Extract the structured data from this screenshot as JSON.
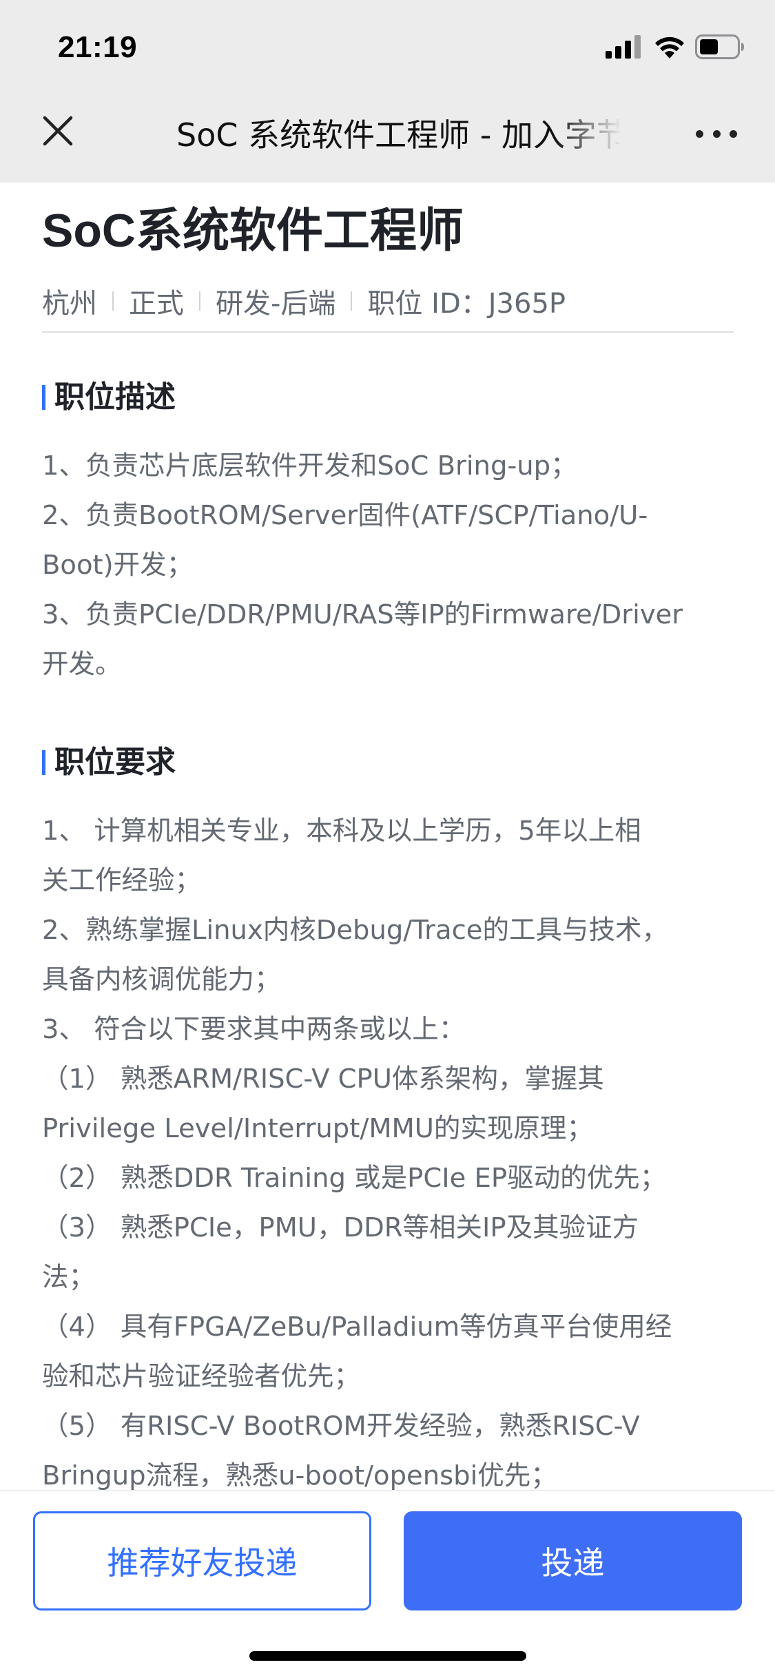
{
  "status_bar": {
    "time": "21:19",
    "icons": [
      "cellular-signal-icon",
      "wifi-icon",
      "battery-icon"
    ],
    "battery_level": 0.5
  },
  "nav": {
    "close_icon": "close-icon",
    "title": "SoC 系统软件工程师 - 加入字节跳动",
    "more_icon": "more-dots-icon"
  },
  "job": {
    "title": "SoC系统软件工程师",
    "meta": {
      "city": "杭州",
      "type": "正式",
      "category": "研发-后端",
      "job_id": "职位 ID：J365P"
    }
  },
  "sections": {
    "description": {
      "heading": "职位描述",
      "lines": [
        "1、负责芯片底层软件开发和SoC Bring-up；",
        "2、负责BootROM/Server固件(ATF/SCP/Tiano/U-",
        "Boot)开发；",
        "3、负责PCIe/DDR/PMU/RAS等IP的Firmware/Driver",
        "开发。"
      ]
    },
    "requirements": {
      "heading": "职位要求",
      "lines": [
        "1、 计算机相关专业，本科及以上学历，5年以上相",
        "关工作经验；",
        "2、熟练掌握Linux内核Debug/Trace的工具与技术，",
        "具备内核调优能力；",
        "3、 符合以下要求其中两条或以上：",
        "（1） 熟悉ARM/RISC-V CPU体系架构，掌握其",
        "Privilege Level/Interrupt/MMU的实现原理；",
        "（2） 熟悉DDR Training 或是PCIe EP驱动的优先；",
        "（3） 熟悉PCIe，PMU，DDR等相关IP及其验证方",
        "法；",
        "（4） 具有FPGA/ZeBu/Palladium等仿真平台使用经",
        "验和芯片验证经验者优先；",
        "（5） 有RISC-V BootROM开发经验，熟悉RISC-V",
        "Bringup流程，熟悉u-boot/opensbi优先；"
      ]
    }
  },
  "actions": {
    "refer_label": "推荐好友投递",
    "apply_label": "投递"
  },
  "colors": {
    "accent": "#3370ff",
    "apply_button": "#3e6ef5",
    "body_text": "#646a73",
    "heading_text": "#1f2329",
    "topbar_bg": "#ececed"
  }
}
